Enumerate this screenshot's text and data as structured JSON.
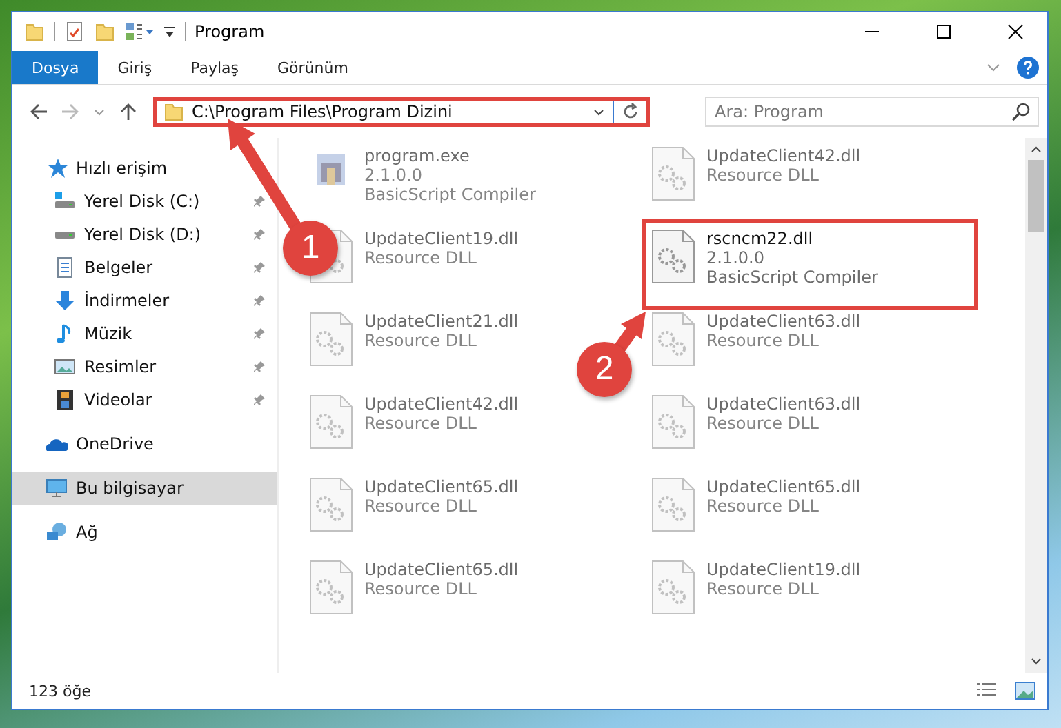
{
  "window": {
    "title": "Program"
  },
  "ribbon": {
    "tabs": [
      {
        "label": "Dosya",
        "selected": true
      },
      {
        "label": "Giriş",
        "selected": false
      },
      {
        "label": "Paylaş",
        "selected": false
      },
      {
        "label": "Görünüm",
        "selected": false
      }
    ]
  },
  "address_bar": {
    "path": "C:\\Program Files\\Program Dizini",
    "annotated": true
  },
  "search": {
    "placeholder": "Ara: Program"
  },
  "sidebar": {
    "items": [
      {
        "label": "Hızlı erişim",
        "kind": "star",
        "selected": false,
        "children": [
          {
            "label": "Yerel Disk (C:)",
            "kind": "disk-windows",
            "pinned": true,
            "selected": false
          },
          {
            "label": "Yerel Disk (D:)",
            "kind": "disk",
            "pinned": true,
            "selected": false
          },
          {
            "label": "Belgeler",
            "kind": "documents",
            "pinned": true,
            "selected": false
          },
          {
            "label": "İndirmeler",
            "kind": "download",
            "pinned": true,
            "selected": false
          },
          {
            "label": "Müzik",
            "kind": "music",
            "pinned": true,
            "selected": false
          },
          {
            "label": "Resimler",
            "kind": "pictures",
            "pinned": true,
            "selected": false
          },
          {
            "label": "Videolar",
            "kind": "videos",
            "pinned": true,
            "selected": false
          }
        ]
      },
      {
        "label": "OneDrive",
        "kind": "cloud",
        "selected": false
      },
      {
        "label": "Bu bilgisayar",
        "kind": "computer",
        "selected": true
      },
      {
        "label": "Ağ",
        "kind": "network",
        "selected": false
      }
    ]
  },
  "files": [
    {
      "name": "program.exe",
      "kind": "exe",
      "details": [
        "2.1.0.0",
        "BasicScript Compiler"
      ],
      "blurred": true,
      "annotated": false
    },
    {
      "name": "UpdateClient42.dll",
      "kind": "dll",
      "details": [
        "Resource DLL"
      ],
      "blurred": true,
      "annotated": false
    },
    {
      "name": "UpdateClient19.dll",
      "kind": "dll",
      "details": [
        "Resource DLL"
      ],
      "blurred": true,
      "annotated": false
    },
    {
      "name": "rscncm22.dll",
      "kind": "dll",
      "details": [
        "2.1.0.0",
        "BasicScript Compiler"
      ],
      "blurred": false,
      "annotated": true
    },
    {
      "name": "UpdateClient21.dll",
      "kind": "dll",
      "details": [
        "Resource DLL"
      ],
      "blurred": true,
      "annotated": false
    },
    {
      "name": "UpdateClient63.dll",
      "kind": "dll",
      "details": [
        "Resource DLL"
      ],
      "blurred": true,
      "annotated": false
    },
    {
      "name": "UpdateClient42.dll",
      "kind": "dll",
      "details": [
        "Resource DLL"
      ],
      "blurred": true,
      "annotated": false
    },
    {
      "name": "UpdateClient63.dll",
      "kind": "dll",
      "details": [
        "Resource DLL"
      ],
      "blurred": true,
      "annotated": false
    },
    {
      "name": "UpdateClient65.dll",
      "kind": "dll",
      "details": [
        "Resource DLL"
      ],
      "blurred": true,
      "annotated": false
    },
    {
      "name": "UpdateClient65.dll",
      "kind": "dll",
      "details": [
        "Resource DLL"
      ],
      "blurred": true,
      "annotated": false
    },
    {
      "name": "UpdateClient65.dll",
      "kind": "dll",
      "details": [
        "Resource DLL"
      ],
      "blurred": true,
      "annotated": false
    },
    {
      "name": "UpdateClient19.dll",
      "kind": "dll",
      "details": [
        "Resource DLL"
      ],
      "blurred": true,
      "annotated": false
    }
  ],
  "annotations": [
    {
      "number": "1"
    },
    {
      "number": "2"
    }
  ],
  "status_bar": {
    "item_count": "123 öğe"
  }
}
